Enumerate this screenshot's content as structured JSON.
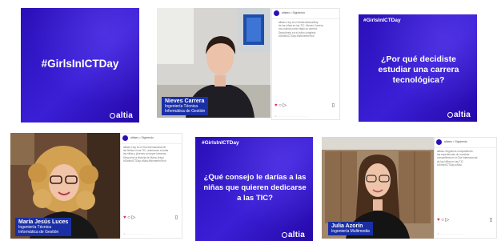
{
  "card1": {
    "headline": "#GirlsInICTDay",
    "logo": "altia"
  },
  "video1": {
    "name": "Nieves Carrera",
    "role_line1": "Ingeniería Técnica",
    "role_line2": "Informática de Gestión"
  },
  "card2": {
    "tag": "#GirlsInICTDay",
    "headline": "¿Por qué decidiste estudiar una carrera tecnológica?",
    "logo": "altia"
  },
  "video2": {
    "name": "María Jesús Luces",
    "role_line1": "Ingeniería Técnica",
    "role_line2": "Informática de Gestión"
  },
  "card3": {
    "tag": "#GirlsInICTDay",
    "headline": "¿Qué consejo le darías a las niñas que quieren dedicarse a las TIC?",
    "logo": "altia"
  },
  "video3": {
    "name": "Julia Azorín",
    "role": "Ingeniería Multimedia"
  },
  "ig_account": "altiaeu",
  "ig_follow": "Siguiendo",
  "ig_posts": [
    {
      "caption": "altiaeu Hoy es el #InternationalDay\nde las niñas en las TIC. Nieves Carrera\nnos cuenta cómo eligió su carrera\nDescúbrelo en el vídeo completo\n#GirlsInICTDay #WomenInTech"
    },
    {
      "caption": "altiaeu Hoy en el Día Internacional de\nlas Niñas en las TIC, animamos a todas\nlas niñas y jóvenes a romper barreras\nDescubre la historia de María Jesús\n#GirlsInICTDay #Altia #WomenInTech"
    },
    {
      "caption": "altiaeu Seguimos compartiendo\nlas experiencias de nuestras\ncompañeras en el Día Internacional\nde las Niñas en las TIC\n#GirlsInICTDay #Altia"
    }
  ]
}
